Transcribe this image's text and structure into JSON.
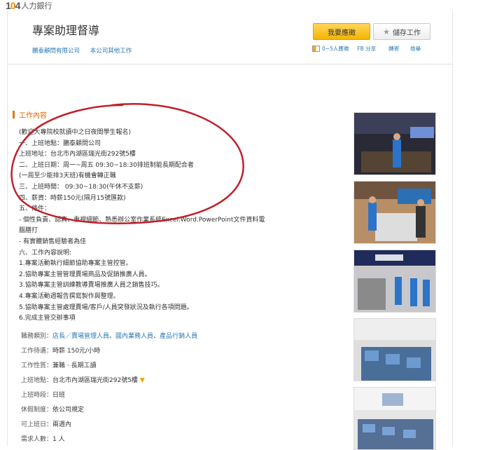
{
  "site": {
    "logo_number": "104",
    "brand": "人力銀行"
  },
  "job": {
    "title": "專案助理督導",
    "company": "鵬泰顧問有限公司",
    "other_jobs": "本公司其他工作"
  },
  "actions": {
    "apply": "我要應徵",
    "save": "儲存工作",
    "applicants": "0~5人應徵",
    "fb_share": "FB 分享",
    "forward": "轉寄",
    "report": "檢舉"
  },
  "section": {
    "title": "工作內容"
  },
  "description": [
    "(歡迎大專院校就讀中之日夜間學生報名)",
    "一、上班地點：鵬泰顧問公司",
    "上班地址：台北市內湖區瑞光街292號5樓",
    "二、上班日期：周一~周五 09:30~18:30排班制能長期配合者",
    "(一周至少能排3天班)有機會轉正職",
    "三、上班時間： 09:30~18:30(午休不支薪)",
    "四、薪資：時薪150元(隔月15號匯款)",
    "五、條件：",
    "- 個性負責、認真、重視細節、熟悉辦公室作業系統Excel.Word.PowerPoint文件資料電",
    "腦膳打",
    "- 有實體銷售經驗者為佳",
    "六、工作內容說明:",
    "1.專案活動執行細節協助專案主管控管。",
    "2.協助專案主管管理賣場商品及促銷推廣人員。",
    "3.協助專案主管訓練教導賣場推廣人員之銷售技巧。",
    "4.專案活動週報告撰寫製作與整理。",
    "5.協助專案主管處理賣場/客戶/人員突發狀況及執行各項問題。",
    "6.完成主管交辦事項"
  ],
  "details": {
    "category_label": "職務類別：",
    "categories": [
      "店長／賣場管理人員",
      "國內業務人員",
      "產品行銷人員"
    ],
    "category_sep": "、",
    "pay_label": "工作待遇：",
    "pay": "時薪 150元/小時",
    "nature_label": "工作性質：",
    "nature": "兼職 · 長期工讀",
    "location_label": "上班地點：",
    "location": "台北市內湖區瑞光街292號5樓",
    "shift_label": "上班時段：",
    "shift": "日班",
    "holiday_label": "休假制度：",
    "holiday": "依公司規定",
    "start_label": "可上班日：",
    "start": "兩週內",
    "headcount_label": "需求人數：",
    "headcount": "1 人"
  },
  "photo_icons": [
    "store-photo-icon",
    "store-photo-icon",
    "store-photo-icon",
    "meeting-photo-icon",
    "meeting-photo-icon"
  ],
  "colors": {
    "link": "#2878b4",
    "accent": "#e07b00",
    "apply_button": "#f5b400",
    "oval": "#c0202a"
  }
}
